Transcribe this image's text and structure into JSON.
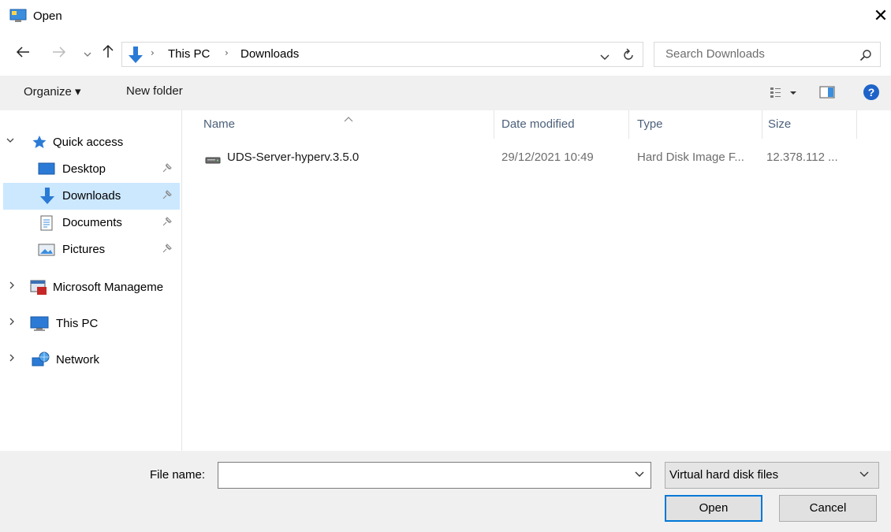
{
  "window": {
    "title": "Open",
    "close_glyph": "✕"
  },
  "nav": {
    "breadcrumbs": [
      "This PC",
      "Downloads"
    ],
    "search_placeholder": "Search Downloads"
  },
  "toolbar": {
    "organize_label": "Organize ▾",
    "new_folder_label": "New folder"
  },
  "sidebar": {
    "quick_access": "Quick access",
    "items": [
      {
        "label": "Desktop",
        "pinned": true
      },
      {
        "label": "Downloads",
        "pinned": true,
        "selected": true
      },
      {
        "label": "Documents",
        "pinned": true
      },
      {
        "label": "Pictures",
        "pinned": true
      }
    ],
    "groups": [
      {
        "label": "Microsoft Manageme"
      },
      {
        "label": "This PC"
      },
      {
        "label": "Network"
      }
    ]
  },
  "columns": {
    "name": "Name",
    "date": "Date modified",
    "type": "Type",
    "size": "Size"
  },
  "files": [
    {
      "name": "UDS-Server-hyperv.3.5.0",
      "date": "29/12/2021 10:49",
      "type": "Hard Disk Image F...",
      "size": "12.378.112 ..."
    }
  ],
  "bottom": {
    "file_name_label": "File name:",
    "file_name_value": "",
    "filter_value": "Virtual hard disk files",
    "open_label": "Open",
    "cancel_label": "Cancel"
  },
  "colors": {
    "accent": "#0078d7",
    "selection": "#cce8ff",
    "header_text": "#4c607a"
  }
}
